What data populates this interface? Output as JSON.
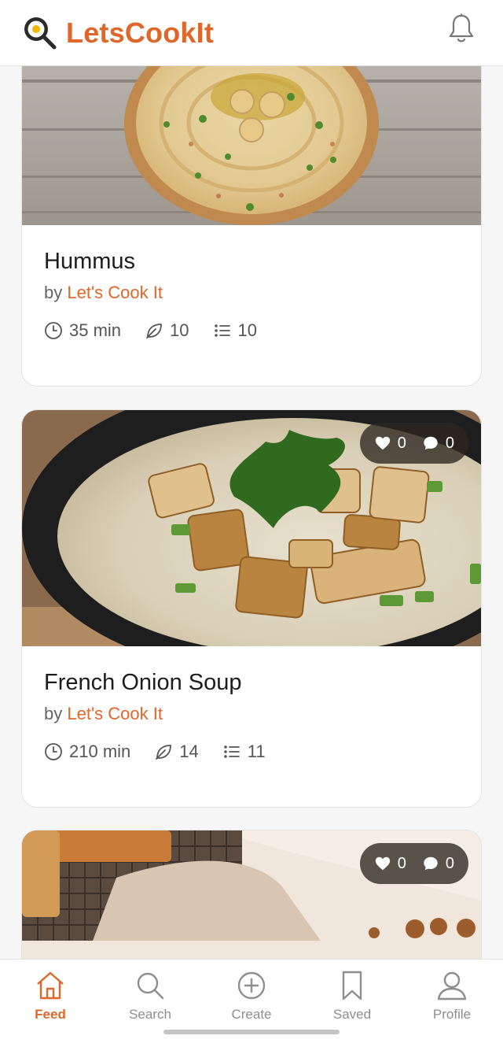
{
  "header": {
    "brand": "LetsCookIt",
    "logo_icon": "frying-pan-egg-icon",
    "notification_icon": "bell-icon"
  },
  "feed": {
    "recipes": [
      {
        "title": "Hummus",
        "by_prefix": "by ",
        "author": "Let's Cook It",
        "time": "35 min",
        "ingredients": "10",
        "steps": "10",
        "likes": null,
        "comments": null
      },
      {
        "title": "French Onion Soup",
        "by_prefix": "by ",
        "author": "Let's Cook It",
        "time": "210 min",
        "ingredients": "14",
        "steps": "11",
        "likes": "0",
        "comments": "0"
      },
      {
        "likes": "0",
        "comments": "0"
      }
    ]
  },
  "nav": {
    "items": [
      {
        "label": "Feed",
        "icon": "home-icon",
        "active": true
      },
      {
        "label": "Search",
        "icon": "search-icon",
        "active": false
      },
      {
        "label": "Create",
        "icon": "plus-circle-icon",
        "active": false
      },
      {
        "label": "Saved",
        "icon": "bookmark-icon",
        "active": false
      },
      {
        "label": "Profile",
        "icon": "user-icon",
        "active": false
      }
    ]
  },
  "colors": {
    "accent": "#e0672a",
    "muted_text": "#666666",
    "nav_inactive": "#8e8e8e"
  }
}
